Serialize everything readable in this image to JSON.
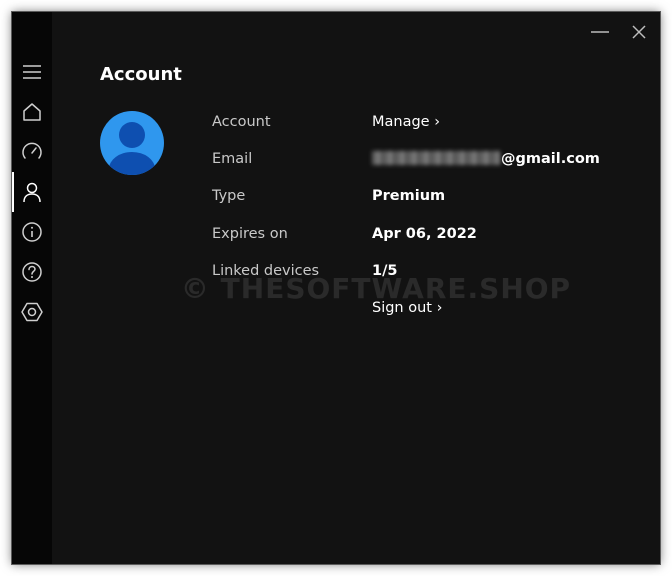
{
  "window": {
    "minimize_icon": "minimize-icon",
    "close_icon": "close-icon"
  },
  "sidebar": {
    "items": [
      {
        "icon": "hamburger-menu-icon",
        "name": "menu"
      },
      {
        "icon": "home-icon",
        "name": "home"
      },
      {
        "icon": "speedometer-icon",
        "name": "speed"
      },
      {
        "icon": "person-icon",
        "name": "account",
        "active": true
      },
      {
        "icon": "info-icon",
        "name": "info"
      },
      {
        "icon": "help-icon",
        "name": "help"
      },
      {
        "icon": "settings-hexagon-icon",
        "name": "settings"
      }
    ]
  },
  "account": {
    "title": "Account",
    "rows": [
      {
        "label": "Account",
        "value": "Manage ›"
      },
      {
        "label": "Email",
        "value": "@gmail.com"
      },
      {
        "label": "Type",
        "value": "Premium"
      },
      {
        "label": "Expires on",
        "value": "Apr 06, 2022"
      },
      {
        "label": "Linked devices",
        "value": "1/5"
      }
    ],
    "sign_out": "Sign out ›"
  },
  "watermark": "© THESOFTWARE.SHOP",
  "colors": {
    "background": "#121212",
    "sidebar": "#060606",
    "avatar": "#2f97ee",
    "avatar_figure": "#0e4fb0"
  }
}
